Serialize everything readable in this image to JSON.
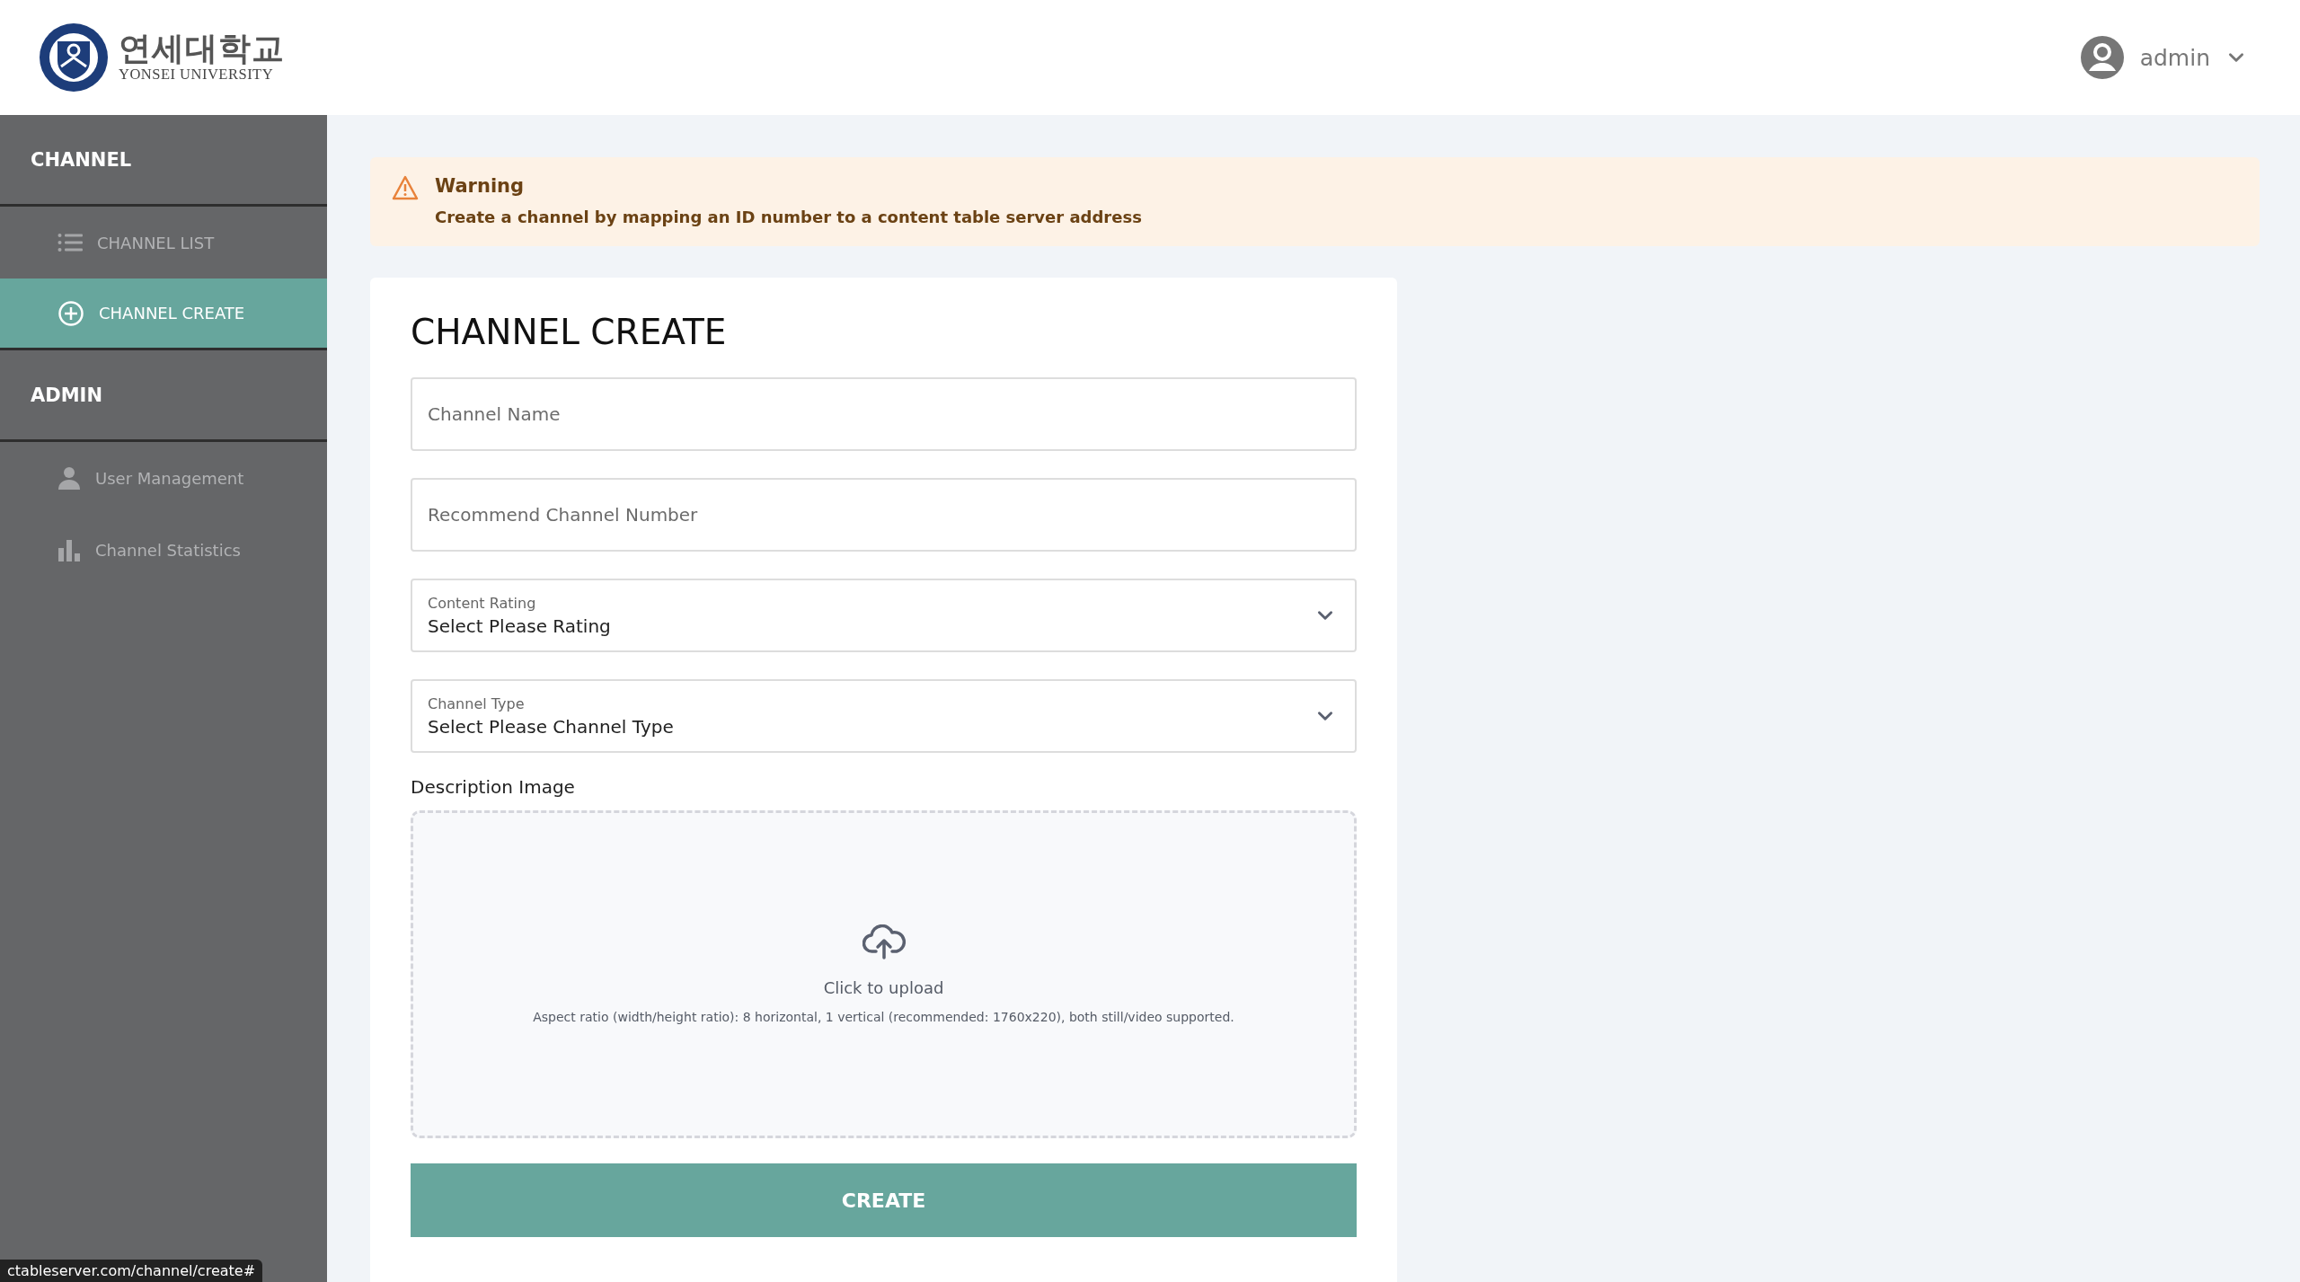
{
  "header": {
    "logo": {
      "korean": "연세대학교",
      "english": "YONSEI UNIVERSITY"
    },
    "user": {
      "name": "admin"
    }
  },
  "sidebar": {
    "sections": [
      {
        "title": "CHANNEL",
        "items": [
          {
            "label": "CHANNEL LIST",
            "selected": false
          },
          {
            "label": "CHANNEL CREATE",
            "selected": true
          }
        ]
      },
      {
        "title": "ADMIN",
        "items": [
          {
            "label": "User Management",
            "selected": false
          },
          {
            "label": "Channel Statistics",
            "selected": false
          }
        ]
      }
    ]
  },
  "warning": {
    "title": "Warning",
    "message": "Create a channel by mapping an ID number to a content table server address"
  },
  "form": {
    "title": "CHANNEL CREATE",
    "fields": [
      {
        "kind": "text",
        "placeholder": "Channel Name"
      },
      {
        "kind": "text",
        "placeholder": "Recommend Channel Number"
      },
      {
        "kind": "select",
        "label": "Content Rating",
        "value": "Select Please Rating"
      },
      {
        "kind": "select",
        "label": "Channel Type",
        "value": "Select Please Channel Type"
      }
    ],
    "upload": {
      "label": "Description Image",
      "prompt": "Click to upload",
      "hint": "Aspect ratio (width/height ratio): 8 horizontal, 1 vertical (recommended: 1760x220), both still/video supported."
    },
    "submit": "CREATE"
  },
  "status_bar": {
    "url": "ctableserver.com/channel/create#"
  }
}
